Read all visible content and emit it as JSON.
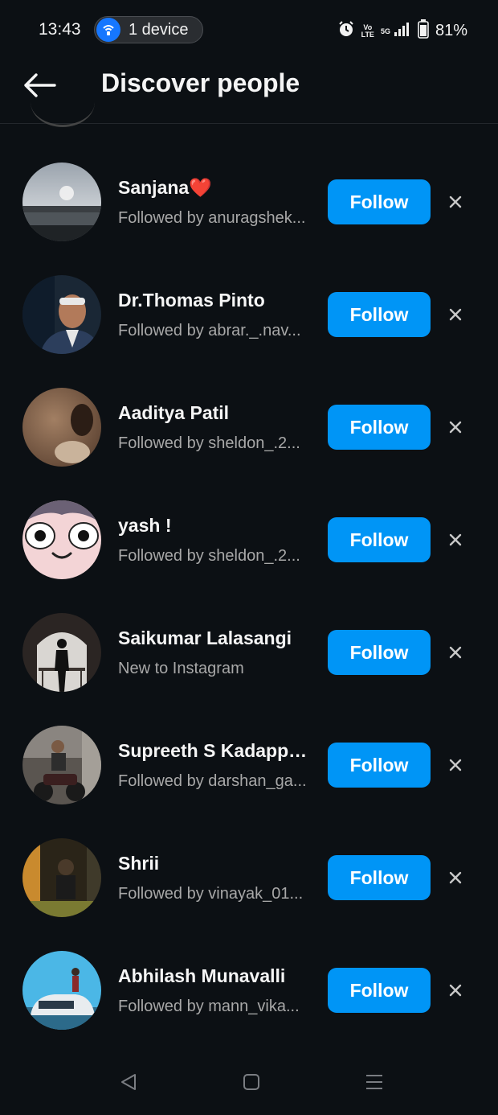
{
  "status_bar": {
    "time": "13:43",
    "device_pill": "1 device",
    "battery": "81%",
    "volte_top": "Vo",
    "volte_bottom": "LTE",
    "network": "5G",
    "icons": [
      "alarm-icon",
      "volte-icon",
      "signal-icon",
      "battery-icon"
    ]
  },
  "header": {
    "title": "Discover people",
    "back_icon": "arrow-left-icon"
  },
  "colors": {
    "background": "#0c1014",
    "follow_button": "#0095f6",
    "primary_text": "#f5f5f5",
    "secondary_text": "#a8a8a8"
  },
  "suggestions": [
    {
      "name": "Sanjana",
      "emoji": "❤️",
      "subtitle": "Followed by anuragshek...",
      "button": "Follow",
      "avatar": "lake-sunset-photo"
    },
    {
      "name": "Dr.Thomas Pinto",
      "emoji": "",
      "subtitle": "Followed by abrar._.nav...",
      "button": "Follow",
      "avatar": "man-portrait-photo"
    },
    {
      "name": "Aaditya Patil",
      "emoji": "",
      "subtitle": "Followed by sheldon_.2...",
      "button": "Follow",
      "avatar": "selfie-photo"
    },
    {
      "name": "yash !",
      "emoji": "",
      "subtitle": "Followed by sheldon_.2...",
      "button": "Follow",
      "avatar": "cartoon-face"
    },
    {
      "name": "Saikumar Lalasangi",
      "emoji": "",
      "subtitle": "New to Instagram",
      "button": "Follow",
      "avatar": "silhouette-photo"
    },
    {
      "name": "Supreeth S Kadappa...",
      "emoji": "",
      "subtitle": "Followed by darshan_ga...",
      "button": "Follow",
      "avatar": "motorbike-photo"
    },
    {
      "name": "Shrii",
      "emoji": "",
      "subtitle": "Followed by vinayak_01...",
      "button": "Follow",
      "avatar": "dark-gym-photo"
    },
    {
      "name": "Abhilash Munavalli",
      "emoji": "",
      "subtitle": "Followed by mann_vika...",
      "button": "Follow",
      "avatar": "car-sky-photo"
    }
  ],
  "nav_bar": {
    "buttons": [
      "back-triangle-icon",
      "home-square-icon",
      "menu-lines-icon"
    ]
  }
}
